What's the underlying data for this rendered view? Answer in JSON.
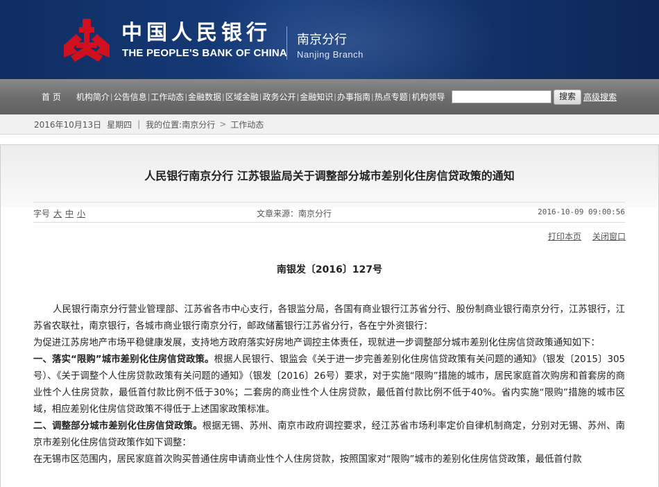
{
  "header": {
    "bank_name_cn": "中国人民银行",
    "bank_name_en": "THE PEOPLE'S BANK OF CHINA",
    "branch_cn": "南京分行",
    "branch_en": "Nanjing  Branch",
    "logo_color": "#d0101f"
  },
  "nav": {
    "home": "首    页",
    "items": [
      "机构简介",
      "公告信息",
      "工作动态",
      "金融数据",
      "区域金融",
      "政务公开",
      "金融知识",
      "办事指南",
      "热点专题",
      "机构领导"
    ],
    "search_placeholder": "",
    "search_button": "搜索",
    "advanced_search": "高级搜索"
  },
  "breadcrumb": {
    "date": "2016年10月13日",
    "weekday": "星期四",
    "location_label": "我的位置:",
    "location_root": "南京分行",
    "location_current": "工作动态"
  },
  "article": {
    "title": "人民银行南京分行  江苏银监局关于调整部分城市差别化住房信贷政策的通知",
    "font_size_label": "字号",
    "font_sizes": [
      "大",
      "中",
      "小"
    ],
    "source": "文章来源：南京分行",
    "time": "2016-10-09 09:00:56",
    "print": "打印本页",
    "close": "关闭窗口",
    "doc_number": "南银发〔2016〕127号",
    "p1": "人民银行南京分行营业管理部、江苏省各市中心支行，各银监分局，各国有商业银行江苏省分行、股份制商业银行南京分行，江苏银行，江苏省农联社，南京银行，各城市商业银行南京分行，邮政储蓄银行江苏省分行，各在宁外资银行：",
    "p2": "为促进江苏房地产市场平稳健康发展，支持地方政府落实好房地产调控主体责任，现就进一步调整部分城市差别化住房信贷政策通知如下：",
    "s1_heading": "一、落实“限购”城市差别化住房信贷政策。",
    "s1_text": "根据人民银行、银监会《关于进一步完善差别化住房信贷政策有关问题的通知》（银发〔2015〕305号）、《关于调整个人住房贷款政策有关问题的通知》（银发〔2016〕26号）要求，对于实施“限购”措施的城市，居民家庭首次购房和首套房的商业性个人住房贷款，最低首付款比例不低于30%；二套房的商业性个人住房贷款，最低首付款比例不低于40%。省内实施“限购”措施的城市区域，相应差别化住房信贷政策不得低于上述国家政策标准。",
    "s2_heading": "二、调整部分城市差别化住房信贷政策。",
    "s2_text": "根据无锡、苏州、南京市政府调控要求，经江苏省市场利率定价自律机制商定，分别对无锡、苏州、南京市差别化住房信贷政策作如下调整：",
    "p_last": "在无锡市区范围内，居民家庭首次购买普通住房申请商业性个人住房贷款，按照国家对“限购”城市的差别化住房信贷政策，最低首付款"
  }
}
